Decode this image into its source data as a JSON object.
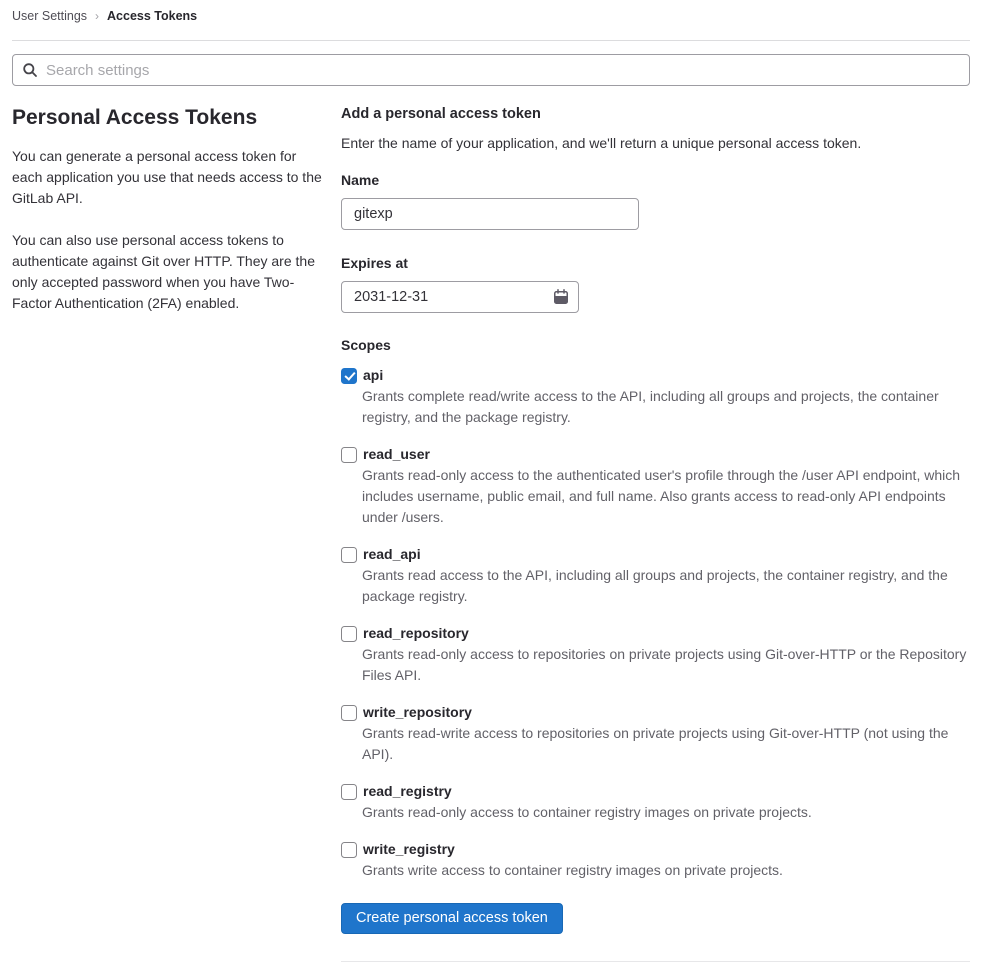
{
  "breadcrumb": {
    "parent": "User Settings",
    "separator": "›",
    "current": "Access Tokens"
  },
  "search": {
    "placeholder": "Search settings"
  },
  "sidebar": {
    "title": "Personal Access Tokens",
    "paragraphs": [
      "You can generate a personal access token for each application you use that needs access to the GitLab API.",
      "You can also use personal access tokens to authenticate against Git over HTTP. They are the only accepted password when you have Two-Factor Authentication (2FA) enabled."
    ]
  },
  "form": {
    "heading": "Add a personal access token",
    "description": "Enter the name of your application, and we'll return a unique personal access token.",
    "name_label": "Name",
    "name_value": "gitexp",
    "expires_label": "Expires at",
    "expires_value": "2031-12-31",
    "scopes_label": "Scopes",
    "scopes": [
      {
        "label": "api",
        "checked": true,
        "description": "Grants complete read/write access to the API, including all groups and projects, the container registry, and the package registry."
      },
      {
        "label": "read_user",
        "checked": false,
        "description": "Grants read-only access to the authenticated user's profile through the /user API endpoint, which includes username, public email, and full name. Also grants access to read-only API endpoints under /users."
      },
      {
        "label": "read_api",
        "checked": false,
        "description": "Grants read access to the API, including all groups and projects, the container registry, and the package registry."
      },
      {
        "label": "read_repository",
        "checked": false,
        "description": "Grants read-only access to repositories on private projects using Git-over-HTTP or the Repository Files API."
      },
      {
        "label": "write_repository",
        "checked": false,
        "description": "Grants read-write access to repositories on private projects using Git-over-HTTP (not using the API)."
      },
      {
        "label": "read_registry",
        "checked": false,
        "description": "Grants read-only access to container registry images on private projects."
      },
      {
        "label": "write_registry",
        "checked": false,
        "description": "Grants write access to container registry images on private projects."
      }
    ],
    "submit_label": "Create personal access token"
  },
  "colors": {
    "accent": "#1f75cb",
    "text_primary": "#28272d",
    "text_secondary": "#626168",
    "input_border": "#9d9ca2",
    "divider": "#dcdcde"
  }
}
